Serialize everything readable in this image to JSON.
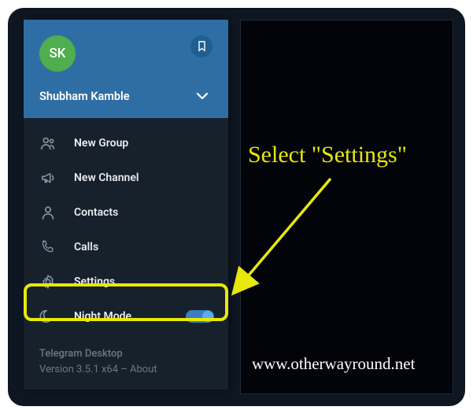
{
  "profile": {
    "initials": "SK",
    "name": "Shubham Kamble"
  },
  "menu": {
    "new_group": "New Group",
    "new_channel": "New Channel",
    "contacts": "Contacts",
    "calls": "Calls",
    "settings": "Settings",
    "night_mode": "Night Mode"
  },
  "footer": {
    "app_name": "Telegram Desktop",
    "version_line": "Version 3.5.1 x64 – About"
  },
  "annotation": {
    "text": "Select \"Settings\""
  },
  "website": "www.otherwayround.net"
}
